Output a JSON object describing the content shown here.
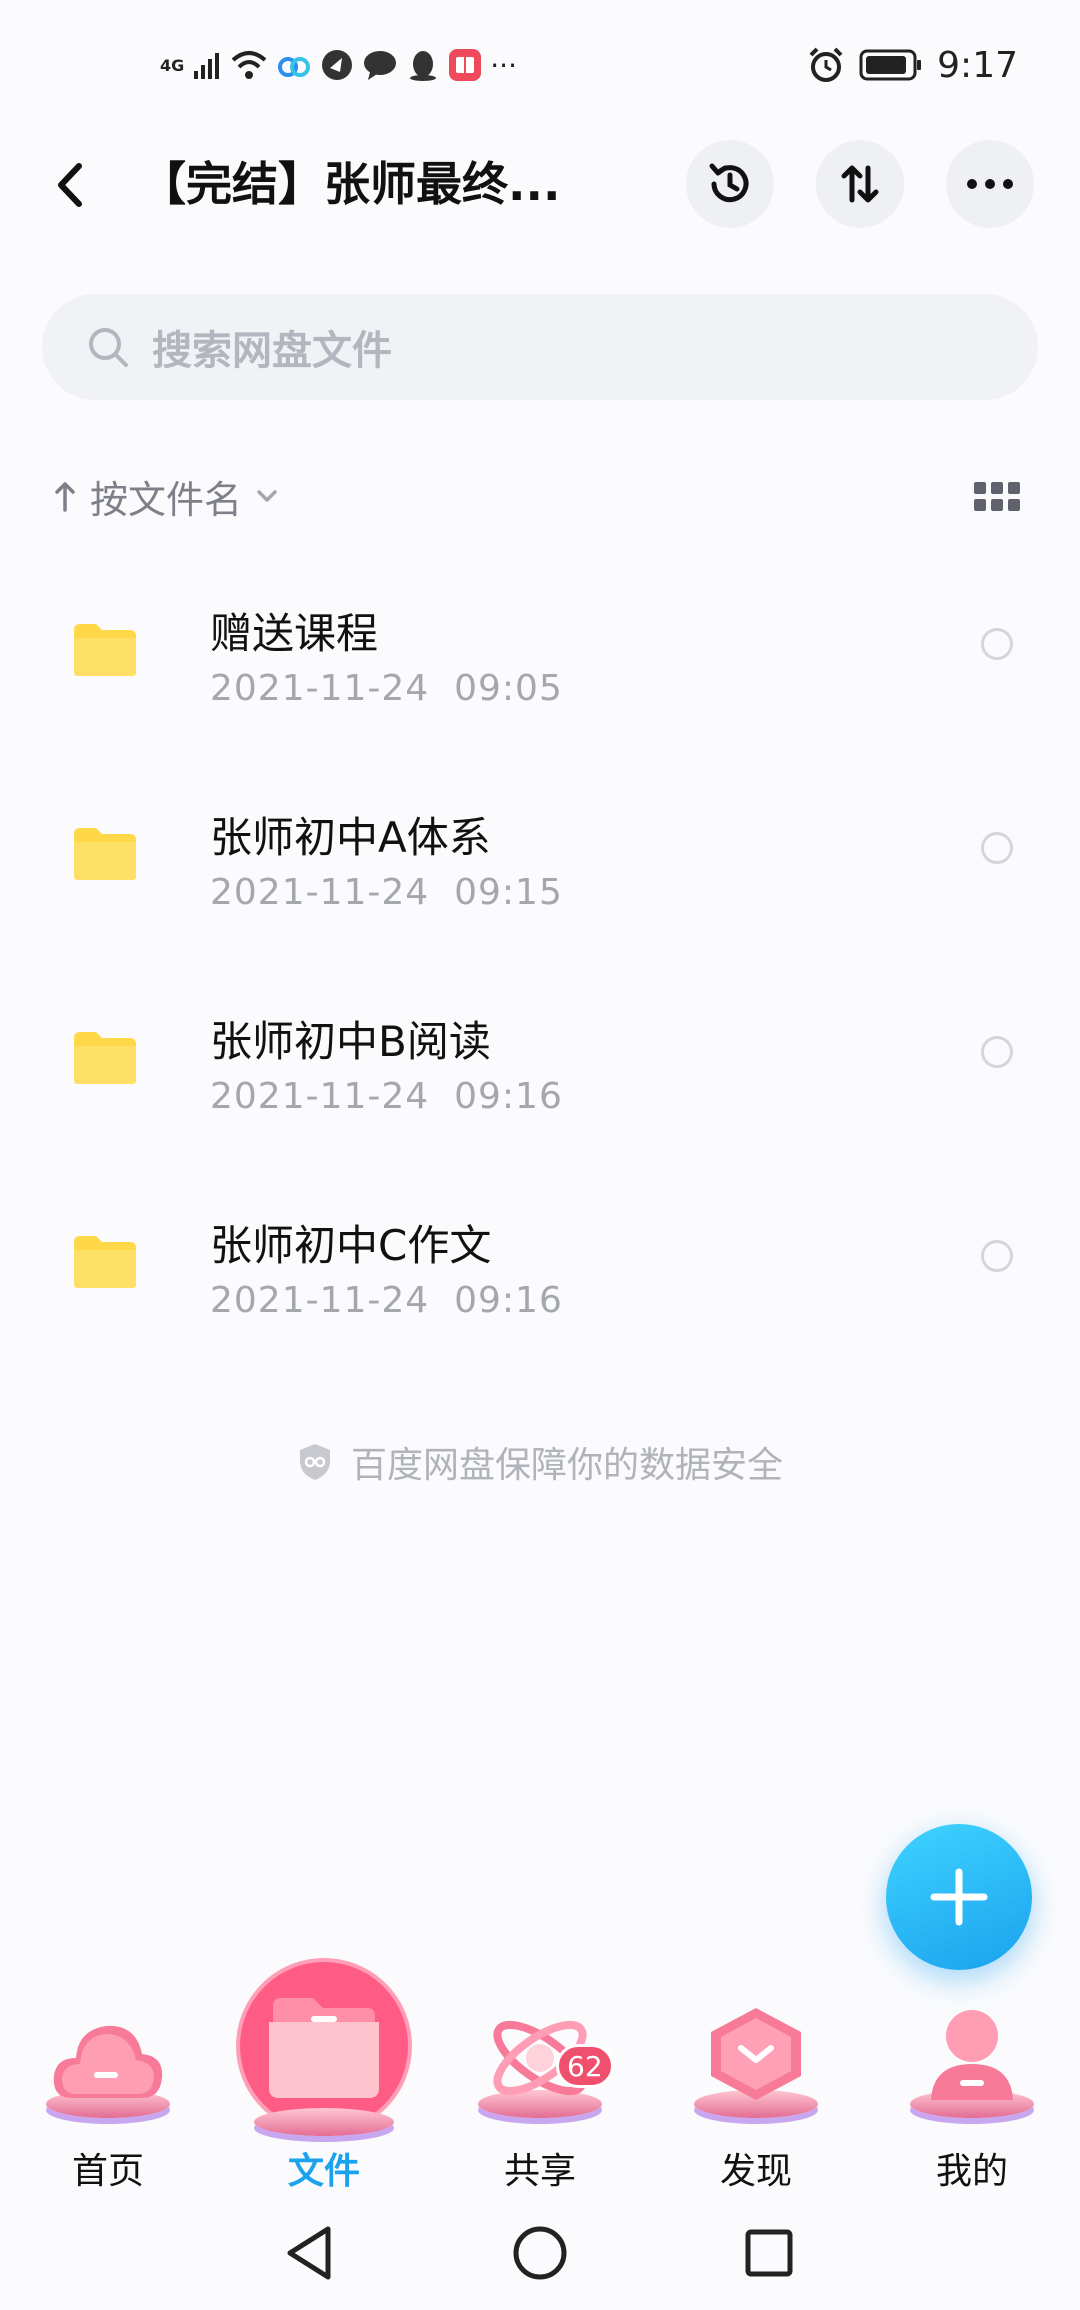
{
  "status_bar": {
    "network": "4G",
    "more": "···",
    "time": "9:17"
  },
  "header": {
    "title": "【完结】张师最终..."
  },
  "search": {
    "placeholder": "搜索网盘文件"
  },
  "sort": {
    "label": "按文件名"
  },
  "files": [
    {
      "name": "赠送课程",
      "time": "2021-11-24  09:05"
    },
    {
      "name": "张师初中A体系",
      "time": "2021-11-24  09:15"
    },
    {
      "name": "张师初中B阅读",
      "time": "2021-11-24  09:16"
    },
    {
      "name": "张师初中C作文",
      "time": "2021-11-24  09:16"
    }
  ],
  "safety_note": "百度网盘保障你的数据安全",
  "tabs": [
    {
      "label": "首页",
      "icon": "cloud-icon"
    },
    {
      "label": "文件",
      "icon": "folder-icon",
      "active": true
    },
    {
      "label": "共享",
      "icon": "atom-icon",
      "badge": "62"
    },
    {
      "label": "发现",
      "icon": "hexagon-icon"
    },
    {
      "label": "我的",
      "icon": "person-icon"
    }
  ],
  "colors": {
    "accent": "#1aa2ee",
    "folder": "#ffd84a",
    "badge": "#f0506e"
  }
}
